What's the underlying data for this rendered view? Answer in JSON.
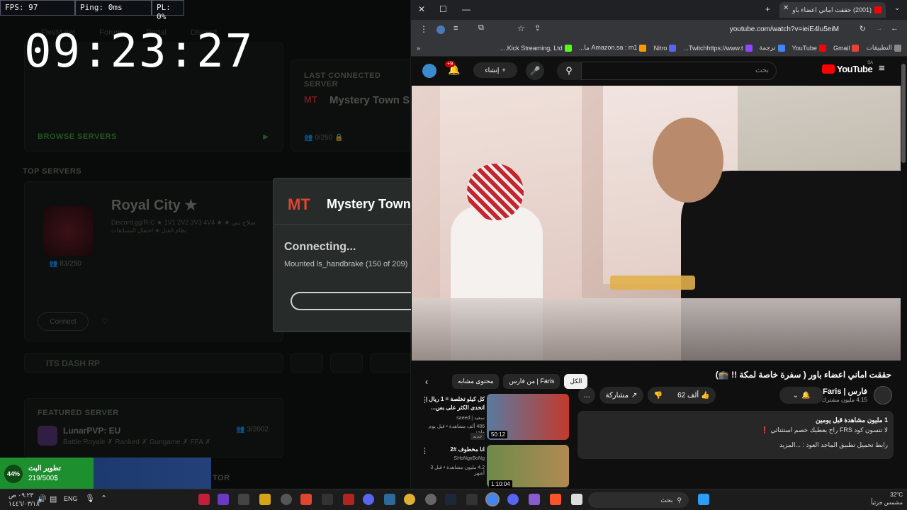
{
  "hud": {
    "fps": "FPS: 97",
    "ping": "Ping: 0ms",
    "pl": "PL: 0%"
  },
  "clock": "09:23:27",
  "fivem": {
    "nav": [
      "FiveM.net",
      "Forum",
      "Portal",
      "Discord"
    ],
    "last_connected_label": "LAST CONNECTED SERVER",
    "last_server_name": "Mystery Town S",
    "last_server_players": "0/250",
    "browse_label": "BROWSE SERVERS",
    "top_servers_label": "TOP SERVERS",
    "royal_name": "Royal City ★",
    "royal_desc": "Discord.gg/R-C ★ 1V1 2V2 3V3 4V4 ★ ★ سلاح بني",
    "royal_desc2": "نظام القتل ★ احتفال المسابقات",
    "royal_players": "83/250",
    "connect_label": "Connect",
    "its_dash": "ITS DASH RP",
    "featured_label": "FEATURED SERVER",
    "lunar_name": "LunarPVP: EU",
    "lunar_desc": "Battle Royale ✗ Ranked ✗ Gungame ✗ FFA ✗",
    "lunar_players": "3/2002",
    "tor_label": "TOR"
  },
  "modal": {
    "title": "Mystery Town",
    "status": "Connecting...",
    "detail": "Mounted ls_handbrake (150 of 209)"
  },
  "browser": {
    "tab_title": "(2001) حققت اماني اعضاء باو",
    "url": "youtube.com/watch?v=ieiE4lu5eiM",
    "bookmarks": [
      "التطبيقات",
      "Gmail",
      "YouTube",
      "ترجمة",
      "Twitchhttps://www.t...",
      "Nitro",
      "Amazon.sa : m1 ما...",
      "Kick Streaming, Ltd...."
    ]
  },
  "youtube": {
    "logo": "YouTube",
    "region": "SA",
    "search_placeholder": "بحث",
    "create_label": "إنشاء",
    "notif_count": "+9",
    "video_title": "حققت اماني اعضاء باور ( سفرة خاصة لمكة !! 🕋)",
    "channel": "Faris | فارس",
    "subs": "4.15 مليون مشترك",
    "likes": "62 ألف",
    "share": "مشاركة",
    "more": "…",
    "desc_line1": "1 مليون مشاهدة  قبل يومين",
    "desc_line2": "لا تنسون كود FRS راح يعطيك خصم استثنائي ❗",
    "desc_line3": "رابط تحميل تطبيق الماجد العود : ...المزيد",
    "chips": [
      "الكل",
      "من فارس | Faris",
      "محتوى مشابه"
    ],
    "rec": [
      {
        "title": "كل كيلو تخلصة = 1 ريال | اتحدى الكثر على بس...",
        "channel": "سعيد | saeed",
        "meta": "486 ألف مشاهدة • قبل يوم واحد",
        "badge": "جديد",
        "duration": "50:12"
      },
      {
        "title": "انا مخطوف #2",
        "channel": "SHoNgxBoNg",
        "meta": "4.2 مليون مشاهدة • قبل 3 أشهر",
        "duration": "1:10:04"
      }
    ]
  },
  "toast": {
    "percent": "44%",
    "title": "تطوير البث",
    "value": "219/500$"
  },
  "taskbar": {
    "time": "٠٩:٢٣ ص",
    "date": "١٤٤٦/٠٣/١٨",
    "lang": "ENG",
    "search": "بحث",
    "weather": "32°C",
    "weather_sub": "مشمس جزئياً"
  },
  "colors": {
    "accent_green": "#3f9a3e",
    "yt_red": "#ff0000",
    "toast_green": "#1e8f2e"
  }
}
